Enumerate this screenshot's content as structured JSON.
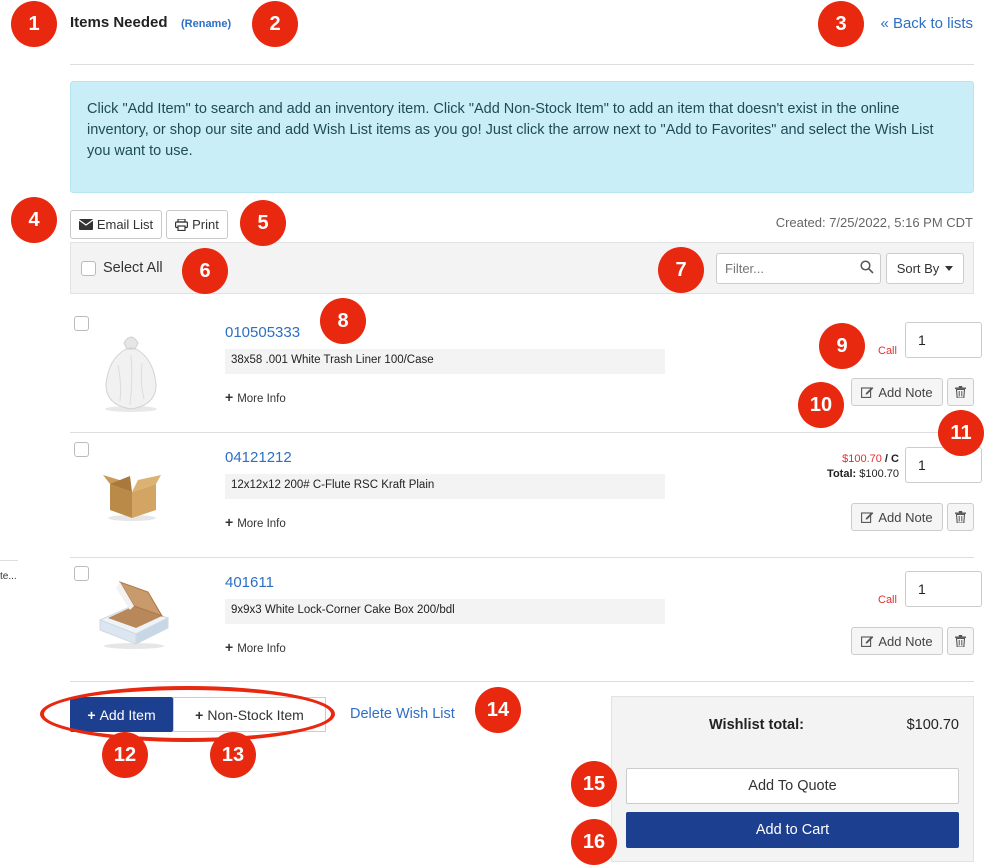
{
  "header": {
    "title": "Items Needed",
    "rename_label": "(Rename)",
    "back_label": "« Back to lists"
  },
  "info_message": "Click \"Add Item\" to search and add an inventory item. Click \"Add Non-Stock Item\" to add an item that doesn't exist in the online inventory, or shop our site and add Wish List items as you go! Just click the arrow next to \"Add to Favorites\" and select the Wish List you want to use.",
  "toolbar": {
    "email_label": "Email List",
    "print_label": "Print",
    "created_text": "Created: 7/25/2022, 5:16 PM CDT"
  },
  "list_controls": {
    "select_all_label": "Select All",
    "filter_placeholder": "Filter...",
    "sort_label": "Sort By"
  },
  "items": [
    {
      "sku": "010505333",
      "description": "38x58 .001 White Trash Liner 100/Case",
      "more_info_label": "More Info",
      "price_text": "Call",
      "quantity": "1",
      "add_note_label": "Add Note"
    },
    {
      "sku": "04121212",
      "description": "12x12x12 200# C-Flute RSC Kraft Plain",
      "more_info_label": "More Info",
      "price_unit": "$100.70",
      "price_unit_suffix": " / C",
      "total_label": "Total:",
      "total_value": " $100.70",
      "quantity": "1",
      "add_note_label": "Add Note"
    },
    {
      "sku": "401611",
      "description": "9x9x3 White Lock-Corner Cake Box 200/bdl",
      "more_info_label": "More Info",
      "price_text": "Call",
      "quantity": "1",
      "add_note_label": "Add Note"
    }
  ],
  "actions": {
    "add_item_label": "Add Item",
    "non_stock_label": "Non-Stock Item",
    "delete_label": "Delete Wish List"
  },
  "summary": {
    "wishlist_total_label": "Wishlist total:",
    "wishlist_total_value": "$100.70",
    "add_quote_label": "Add To Quote",
    "add_cart_label": "Add to Cart"
  },
  "sidebar_fragment": "te...",
  "markers": [
    "1",
    "2",
    "3",
    "4",
    "5",
    "6",
    "7",
    "8",
    "9",
    "10",
    "11",
    "12",
    "13",
    "14",
    "15",
    "16"
  ],
  "colors": {
    "marker": "#e8280f",
    "link": "#2c6fc4",
    "primary_button": "#1d3f8f",
    "info_bg": "#c9eef8",
    "call_red": "#e0302d"
  }
}
